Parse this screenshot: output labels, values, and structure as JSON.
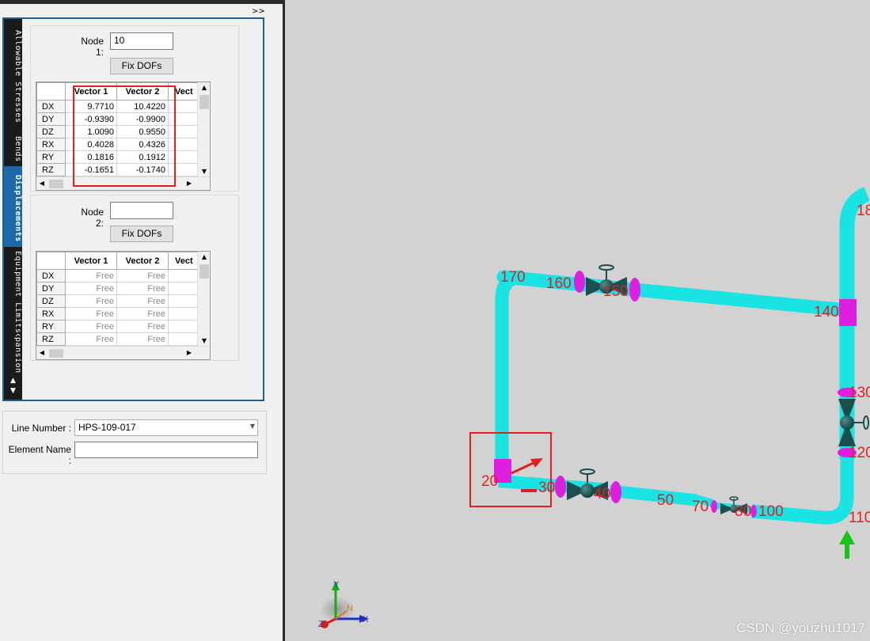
{
  "sidebar": {
    "tabs": [
      {
        "label": "Allowable Stresses",
        "active": false
      },
      {
        "label": "Bends",
        "active": false
      },
      {
        "label": "Displacements",
        "active": true
      },
      {
        "label": "Equipment Limits",
        "active": false
      },
      {
        "label": "Expansion Jo",
        "active": false
      }
    ],
    "collapse_label": ">>",
    "scroll_up": "▲",
    "scroll_down": "▼"
  },
  "node1": {
    "label": "Node 1:",
    "value": "10",
    "fix_button": "Fix DOFs",
    "columns": [
      "Vector 1",
      "Vector 2",
      "Vect"
    ],
    "rows": [
      {
        "dof": "DX",
        "v1": "9.7710",
        "v2": "10.4220"
      },
      {
        "dof": "DY",
        "v1": "-0.9390",
        "v2": "-0.9900"
      },
      {
        "dof": "DZ",
        "v1": "1.0090",
        "v2": "0.9550"
      },
      {
        "dof": "RX",
        "v1": "0.4028",
        "v2": "0.4326"
      },
      {
        "dof": "RY",
        "v1": "0.1816",
        "v2": "0.1912"
      },
      {
        "dof": "RZ",
        "v1": "-0.1651",
        "v2": "-0.1740"
      }
    ]
  },
  "node2": {
    "label": "Node 2:",
    "value": "",
    "fix_button": "Fix DOFs",
    "columns": [
      "Vector 1",
      "Vector 2",
      "Vect"
    ],
    "rows": [
      {
        "dof": "DX",
        "v1": "Free",
        "v2": "Free"
      },
      {
        "dof": "DY",
        "v1": "Free",
        "v2": "Free"
      },
      {
        "dof": "DZ",
        "v1": "Free",
        "v2": "Free"
      },
      {
        "dof": "RX",
        "v1": "Free",
        "v2": "Free"
      },
      {
        "dof": "RY",
        "v1": "Free",
        "v2": "Free"
      },
      {
        "dof": "RZ",
        "v1": "Free",
        "v2": "Free"
      }
    ]
  },
  "properties": {
    "line_number_label": "Line Number :",
    "line_number_value": "HPS-109-017",
    "element_name_label": "Element Name :",
    "element_name_value": ""
  },
  "viewport": {
    "node_labels": [
      "170",
      "160",
      "150",
      "140",
      "130",
      "120",
      "110",
      "100",
      "80",
      "70",
      "50",
      "40",
      "30",
      "20",
      "18"
    ],
    "axis_labels": {
      "x": "X",
      "y": "Y",
      "z": "Z",
      "n": "N"
    },
    "watermark": "CSDN @youzhu1017",
    "colors": {
      "pipe": "#19e3e3",
      "fitting": "#e01ee0",
      "label": "#e81d1d",
      "background": "#d2d2d2",
      "highlight": "#e02020",
      "restraint": "#17c417"
    }
  }
}
